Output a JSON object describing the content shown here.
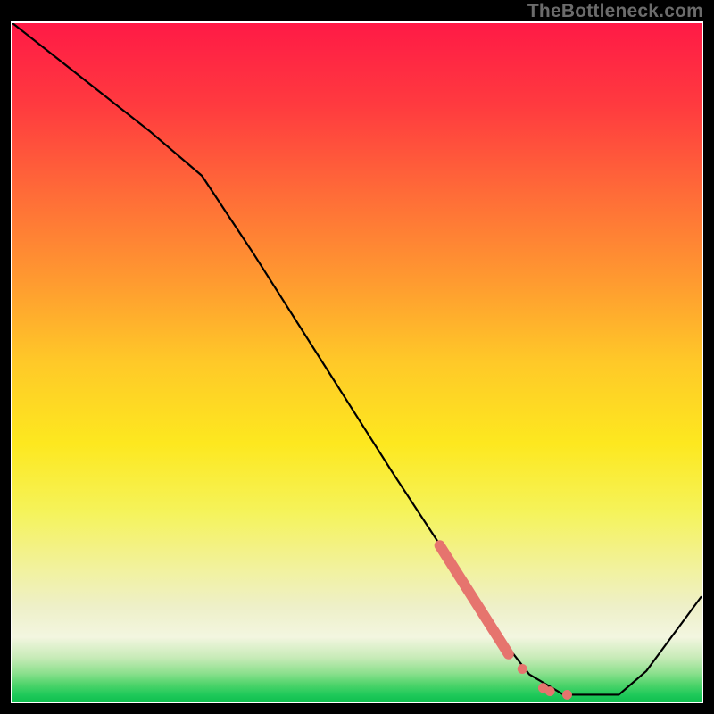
{
  "watermark": "TheBottleneck.com",
  "chart_data": {
    "type": "line",
    "title": "",
    "xlabel": "",
    "ylabel": "",
    "xlim": [
      0,
      100
    ],
    "ylim": [
      0,
      100
    ],
    "background": "vertical rainbow gradient (red-top → green-bottom) with thin bright green band at bottom",
    "curve": {
      "description": "black line descending from upper-left, leveling near bottom around x≈80, then rising toward right edge",
      "points": [
        {
          "x": 0.0,
          "y": 100.0
        },
        {
          "x": 10.0,
          "y": 92.0
        },
        {
          "x": 20.0,
          "y": 84.0
        },
        {
          "x": 27.5,
          "y": 77.5
        },
        {
          "x": 35.0,
          "y": 66.0
        },
        {
          "x": 45.0,
          "y": 50.0
        },
        {
          "x": 55.0,
          "y": 34.0
        },
        {
          "x": 65.0,
          "y": 18.5
        },
        {
          "x": 70.0,
          "y": 10.5
        },
        {
          "x": 75.0,
          "y": 4.0
        },
        {
          "x": 80.0,
          "y": 1.0
        },
        {
          "x": 85.0,
          "y": 1.0
        },
        {
          "x": 88.0,
          "y": 1.0
        },
        {
          "x": 92.0,
          "y": 4.5
        },
        {
          "x": 100.0,
          "y": 15.5
        }
      ]
    },
    "highlight": {
      "description": "thick salmon-colored segment overlay on descending portion near lower-right, with a few isolated dots",
      "thick_segment": {
        "x0": 62.0,
        "y0": 23.0,
        "x1": 72.0,
        "y1": 7.0
      },
      "dots": [
        {
          "x": 74.0,
          "y": 4.8
        },
        {
          "x": 77.0,
          "y": 2.0
        },
        {
          "x": 78.0,
          "y": 1.5
        },
        {
          "x": 80.5,
          "y": 1.0
        }
      ]
    },
    "gradient_stops": [
      {
        "offset": 0.0,
        "color": "#ff1a46"
      },
      {
        "offset": 0.12,
        "color": "#ff3a3f"
      },
      {
        "offset": 0.25,
        "color": "#ff6b38"
      },
      {
        "offset": 0.38,
        "color": "#ff9a30"
      },
      {
        "offset": 0.5,
        "color": "#ffc928"
      },
      {
        "offset": 0.62,
        "color": "#fde81f"
      },
      {
        "offset": 0.72,
        "color": "#f5f35a"
      },
      {
        "offset": 0.8,
        "color": "#f2f29a"
      },
      {
        "offset": 0.86,
        "color": "#eef0c8"
      },
      {
        "offset": 0.905,
        "color": "#f3f6e0"
      },
      {
        "offset": 0.935,
        "color": "#c8ebb8"
      },
      {
        "offset": 0.958,
        "color": "#8de08e"
      },
      {
        "offset": 0.975,
        "color": "#4fd46b"
      },
      {
        "offset": 0.99,
        "color": "#1fc95a"
      },
      {
        "offset": 1.0,
        "color": "#10c050"
      }
    ],
    "colors": {
      "curve": "#000000",
      "highlight": "#e6746e"
    }
  }
}
